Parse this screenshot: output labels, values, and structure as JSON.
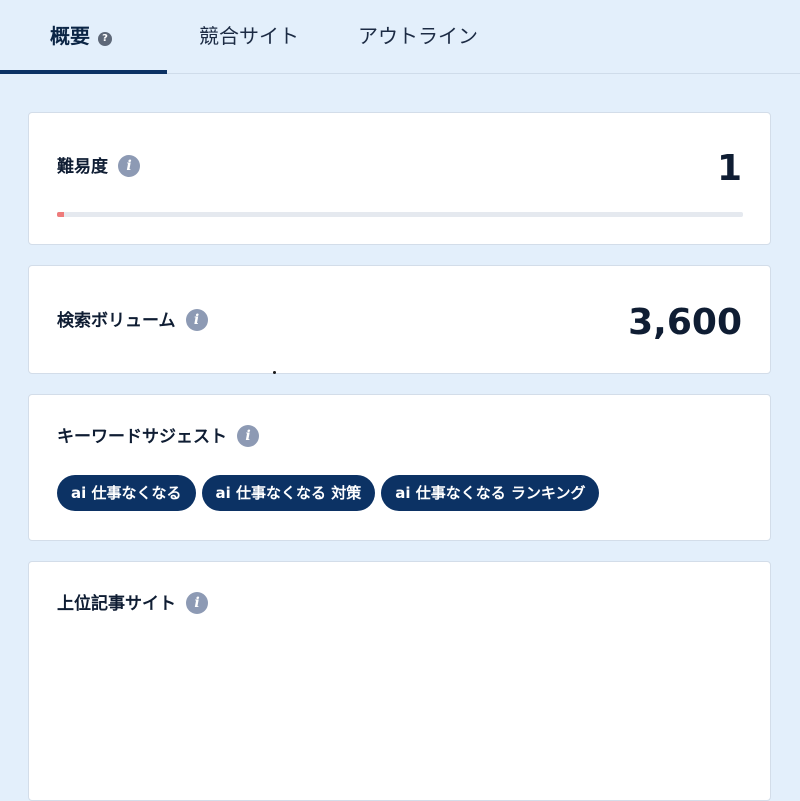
{
  "tabs": [
    {
      "label": "概要",
      "active": true,
      "icon": "help-circle-icon"
    },
    {
      "label": "競合サイト",
      "active": false
    },
    {
      "label": "アウトライン",
      "active": false
    }
  ],
  "difficulty": {
    "title": "難易度",
    "icon": "info-icon",
    "value": "1",
    "progress_percent": 1,
    "bar_color": "#ee7b7b"
  },
  "volume": {
    "title": "検索ボリューム",
    "icon": "info-icon",
    "value": "3,600"
  },
  "suggest": {
    "title": "キーワードサジェスト",
    "icon": "info-icon",
    "chips": [
      "ai 仕事なくなる",
      "ai 仕事なくなる 対策",
      "ai 仕事なくなる ランキング"
    ]
  },
  "top_sites": {
    "title": "上位記事サイト",
    "icon": "info-icon"
  },
  "colors": {
    "accent": "#0c3264",
    "background": "#e3effb",
    "info_icon": "#8d9ab4"
  }
}
